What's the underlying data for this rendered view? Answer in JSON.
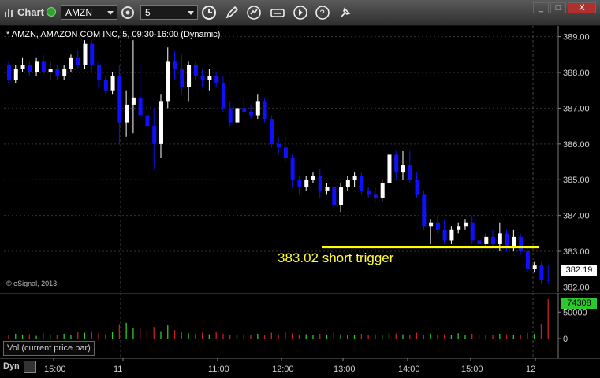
{
  "toolbar": {
    "app_title": "Chart",
    "symbol": "AMZN",
    "interval": "5",
    "tools": [
      "clock-icon",
      "pencil-icon",
      "refresh-icon",
      "chart-type-icon",
      "play-icon",
      "question-icon",
      "pin-icon"
    ],
    "window_controls": [
      "_",
      "□",
      "X"
    ]
  },
  "chart": {
    "header": "* AMZN, AMAZON COM INC, 5, 09:30-16:00 (Dynamic)",
    "watermark": "© eSignal, 2013",
    "annotation": "383.02 short trigger",
    "last_price": "382.19",
    "price_ticks": [
      "389.00",
      "388.00",
      "387.00",
      "386.00",
      "385.00",
      "384.00",
      "383.00",
      "382.00"
    ],
    "trigger_level": 383.02,
    "colors": {
      "up": "#ffffff",
      "down": "#1010ff",
      "trigger": "#ffff00",
      "vol_up": "#2ec82e",
      "vol_down": "#c82020"
    }
  },
  "volume": {
    "label": "Vol (current price bar)",
    "last_volume": "74308",
    "ticks": [
      "50000",
      "0"
    ]
  },
  "time_axis": {
    "mode_label": "Dyn",
    "labels": [
      "15:00",
      "11",
      "11:00",
      "12:00",
      "13:00",
      "14:00",
      "15:00",
      "12"
    ]
  },
  "chart_data": {
    "type": "candlestick",
    "ylim": [
      381.9,
      389.3
    ],
    "candles": [
      [
        388.2,
        388.3,
        387.7,
        387.8
      ],
      [
        387.8,
        388.2,
        387.7,
        388.1
      ],
      [
        388.1,
        388.4,
        388.0,
        388.2
      ],
      [
        388.2,
        388.3,
        387.9,
        388.0
      ],
      [
        388.0,
        388.4,
        387.9,
        388.3
      ],
      [
        388.3,
        388.5,
        387.9,
        388.0
      ],
      [
        388.0,
        388.3,
        387.8,
        388.1
      ],
      [
        388.1,
        388.2,
        387.8,
        387.9
      ],
      [
        387.9,
        388.2,
        387.8,
        388.1
      ],
      [
        388.1,
        388.5,
        388.0,
        388.4
      ],
      [
        388.4,
        388.6,
        388.1,
        388.2
      ],
      [
        388.2,
        388.9,
        388.1,
        388.8
      ],
      [
        388.8,
        388.9,
        388.0,
        388.2
      ],
      [
        388.2,
        388.3,
        387.6,
        387.8
      ],
      [
        387.8,
        387.9,
        387.4,
        387.5
      ],
      [
        387.5,
        388.0,
        387.4,
        387.9
      ],
      [
        387.9,
        388.2,
        386.0,
        386.6
      ],
      [
        386.6,
        387.5,
        386.2,
        387.1
      ],
      [
        387.1,
        388.9,
        386.3,
        387.3
      ],
      [
        387.3,
        388.2,
        386.7,
        386.8
      ],
      [
        386.8,
        387.2,
        386.1,
        386.5
      ],
      [
        386.5,
        387.0,
        385.3,
        386.0
      ],
      [
        386.0,
        387.4,
        385.6,
        387.2
      ],
      [
        387.2,
        388.7,
        387.0,
        388.3
      ],
      [
        388.3,
        388.6,
        387.8,
        388.1
      ],
      [
        388.1,
        388.5,
        387.4,
        387.6
      ],
      [
        387.6,
        388.3,
        387.2,
        388.2
      ],
      [
        388.2,
        388.3,
        387.8,
        387.9
      ],
      [
        387.9,
        388.1,
        387.6,
        387.8
      ],
      [
        387.8,
        388.1,
        387.5,
        387.9
      ],
      [
        387.9,
        388.0,
        387.6,
        387.7
      ],
      [
        387.7,
        387.9,
        386.9,
        387.0
      ],
      [
        387.0,
        387.2,
        386.5,
        386.6
      ],
      [
        386.6,
        387.1,
        386.5,
        387.0
      ],
      [
        387.0,
        387.3,
        386.8,
        386.9
      ],
      [
        386.9,
        387.1,
        386.7,
        386.8
      ],
      [
        386.8,
        387.4,
        386.7,
        387.2
      ],
      [
        387.2,
        387.3,
        386.6,
        386.7
      ],
      [
        386.7,
        386.8,
        385.9,
        386.0
      ],
      [
        386.0,
        386.2,
        385.7,
        385.9
      ],
      [
        385.9,
        386.2,
        385.5,
        385.6
      ],
      [
        385.6,
        385.7,
        384.8,
        385.0
      ],
      [
        385.0,
        385.1,
        384.6,
        384.8
      ],
      [
        384.8,
        385.1,
        384.7,
        385.0
      ],
      [
        385.0,
        385.2,
        384.9,
        385.1
      ],
      [
        385.1,
        385.3,
        384.5,
        384.7
      ],
      [
        384.7,
        384.9,
        384.6,
        384.8
      ],
      [
        384.8,
        384.9,
        384.2,
        384.3
      ],
      [
        384.3,
        384.9,
        384.1,
        384.8
      ],
      [
        384.8,
        385.1,
        384.7,
        385.0
      ],
      [
        385.0,
        385.2,
        384.8,
        385.1
      ],
      [
        385.1,
        385.2,
        384.6,
        384.7
      ],
      [
        384.7,
        384.8,
        384.5,
        384.6
      ],
      [
        384.6,
        384.8,
        384.4,
        384.5
      ],
      [
        384.5,
        385.0,
        384.4,
        384.9
      ],
      [
        384.9,
        385.8,
        384.8,
        385.7
      ],
      [
        385.7,
        385.8,
        385.0,
        385.2
      ],
      [
        385.2,
        385.8,
        385.0,
        385.4
      ],
      [
        385.4,
        385.8,
        384.9,
        385.0
      ],
      [
        385.0,
        385.2,
        384.5,
        384.6
      ],
      [
        384.6,
        384.7,
        383.6,
        383.7
      ],
      [
        383.7,
        383.9,
        383.2,
        383.8
      ],
      [
        383.8,
        384.0,
        383.5,
        383.6
      ],
      [
        383.6,
        383.9,
        383.2,
        383.3
      ],
      [
        383.3,
        383.7,
        383.2,
        383.6
      ],
      [
        383.6,
        383.8,
        383.5,
        383.7
      ],
      [
        383.7,
        383.9,
        383.6,
        383.8
      ],
      [
        383.8,
        384.0,
        383.2,
        383.3
      ],
      [
        383.3,
        383.5,
        383.0,
        383.2
      ],
      [
        383.2,
        383.5,
        383.1,
        383.4
      ],
      [
        383.4,
        383.6,
        383.1,
        383.2
      ],
      [
        383.2,
        383.8,
        383.0,
        383.5
      ],
      [
        383.5,
        383.6,
        383.0,
        383.1
      ],
      [
        383.1,
        383.6,
        383.0,
        383.4
      ],
      [
        383.4,
        383.5,
        382.9,
        383.0
      ],
      [
        383.0,
        383.1,
        382.4,
        382.5
      ],
      [
        382.5,
        382.7,
        382.4,
        382.6
      ],
      [
        382.6,
        382.7,
        382.1,
        382.2
      ],
      [
        382.2,
        382.6,
        382.1,
        382.19
      ]
    ],
    "volumes": [
      6,
      9,
      7,
      8,
      5,
      10,
      8,
      6,
      9,
      7,
      12,
      11,
      14,
      10,
      8,
      13,
      26,
      30,
      20,
      18,
      15,
      22,
      14,
      25,
      16,
      12,
      10,
      9,
      11,
      8,
      13,
      9,
      7,
      6,
      8,
      7,
      9,
      6,
      11,
      8,
      14,
      10,
      7,
      8,
      6,
      9,
      7,
      12,
      8,
      6,
      7,
      9,
      6,
      8,
      7,
      10,
      9,
      8,
      7,
      11,
      6,
      9,
      7,
      8,
      6,
      10,
      7,
      9,
      8,
      6,
      7,
      9,
      8,
      6,
      7,
      11,
      9,
      28,
      46
    ],
    "vol_max": 80000
  }
}
